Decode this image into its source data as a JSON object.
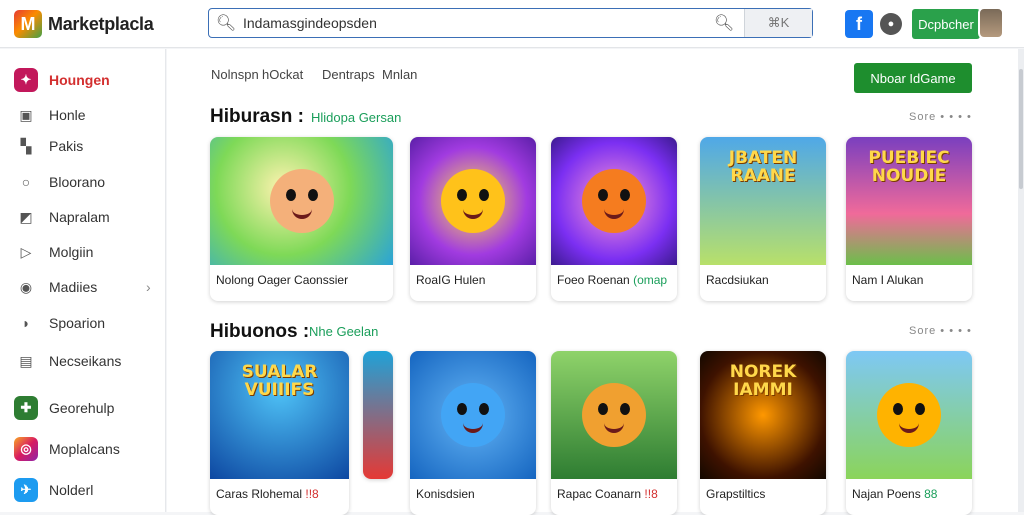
{
  "app": {
    "title": "Marketplacla"
  },
  "search": {
    "value": "Indamasgindeopsden",
    "button_label": "⌘K"
  },
  "header": {
    "primary_button": "Dcpbcher"
  },
  "sidebar": {
    "items": [
      {
        "label": "Houngen",
        "icon": "gamepad-icon",
        "active": true
      },
      {
        "label": "Honle",
        "icon": "home-icon"
      },
      {
        "label": "Pakis",
        "icon": "bookmark-icon"
      },
      {
        "label": "Bloorano",
        "icon": "search-icon"
      },
      {
        "label": "Napralam",
        "icon": "flag-icon"
      },
      {
        "label": "Molgiin",
        "icon": "play-icon"
      },
      {
        "label": "Madiies",
        "icon": "camera-icon",
        "has_chevron": true
      },
      {
        "label": "Spoarion",
        "icon": "shield-icon"
      },
      {
        "label": "Necseikans",
        "icon": "bag-icon"
      },
      {
        "label": "Georehulp",
        "icon": "app-icon"
      },
      {
        "label": "Moplalcans",
        "icon": "instagram-icon"
      },
      {
        "label": "Nolderl",
        "icon": "twitter-icon"
      }
    ]
  },
  "filters": [
    "Nolnspn",
    "hOckat",
    "Dentraps",
    "Mnlan"
  ],
  "cta_button": "Nboar IdGame",
  "sections": [
    {
      "title": "Hiburasn :",
      "subtitle": "Hlidopa Gersan",
      "see_all": "Sore • • • •",
      "cards": [
        {
          "label": "Nolong Oager Caonssier"
        },
        {
          "label": "RoaIG Hulen"
        },
        {
          "label": "Foeo Roenan",
          "tag": "(omap"
        },
        {
          "label": "Racdsiukan",
          "art_text": "JBATEN RAANE"
        },
        {
          "label": "Nam I Alukan",
          "art_text": "PUEBIEC NOUDIE"
        }
      ]
    },
    {
      "title": "Hibuonos :",
      "subtitle": "Nhe Geelan",
      "see_all": "Sore • • • •",
      "cards": [
        {
          "label": "Caras Rlohemal",
          "hot": "!!8",
          "art_text": "SUALAR VUIIIFS"
        },
        {
          "label": ""
        },
        {
          "label": "Konisdsien"
        },
        {
          "label": "Rapac Coanarn",
          "hot": "!!8"
        },
        {
          "label": "Grapstiltics",
          "art_text": "NOREK IAMMI"
        },
        {
          "label": "Najan Poens",
          "tag": "88"
        }
      ]
    }
  ],
  "colors": {
    "accent_green": "#2aa14b",
    "active_red": "#d32f2f",
    "link_blue": "#3b6fb6"
  }
}
